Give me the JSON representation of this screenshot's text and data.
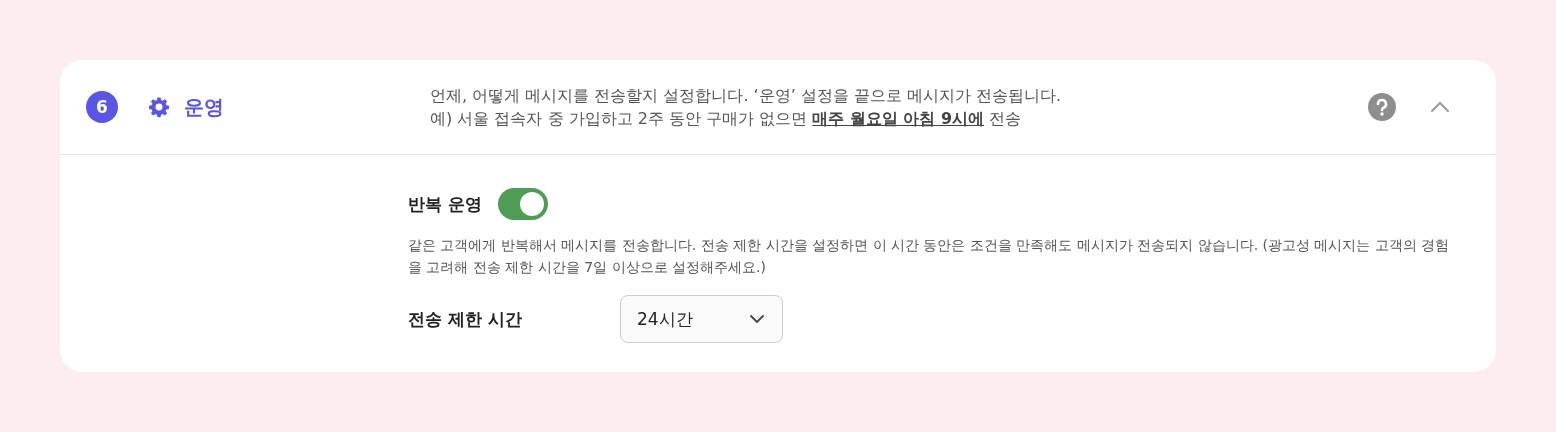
{
  "section": {
    "step": "6",
    "title": "운영",
    "expanded": true,
    "description": "언제, 어떻게 메시지를 전송할지 설정합니다. ‘운영’ 설정을 끝으로 메시지가 전송됩니다.",
    "example": {
      "before": "예) 서울 접속자 중 가입하고 2주 동안 구매가 없으면 ",
      "link": "매주 월요일 아침 9시에",
      "after": " 전송"
    }
  },
  "repeat": {
    "label": "반복 운영",
    "on": true,
    "help": "같은 고객에게 반복해서 메시지를 전송합니다. 전송 제한 시간을 설정하면 이 시간 동안은 조건을 만족해도 메시지가 전송되지 않습니다. (광고성 메시지는 고객의 경험을 고려해 전송 제한 시간을 7일 이상으로 설정해주세요.)"
  },
  "limit": {
    "label": "전송 제한 시간",
    "value": "24시간"
  }
}
